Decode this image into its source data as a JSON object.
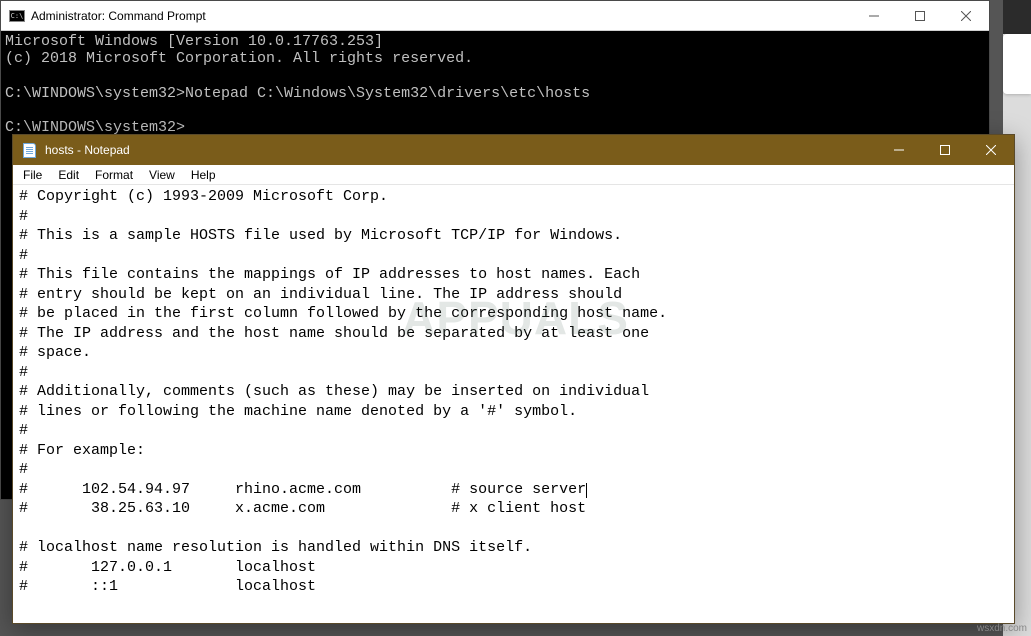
{
  "cmd": {
    "title": "Administrator: Command Prompt",
    "lines": [
      "Microsoft Windows [Version 10.0.17763.253]",
      "(c) 2018 Microsoft Corporation. All rights reserved.",
      "",
      "C:\\WINDOWS\\system32>Notepad C:\\Windows\\System32\\drivers\\etc\\hosts",
      "",
      "C:\\WINDOWS\\system32>"
    ]
  },
  "notepad": {
    "title": "hosts - Notepad",
    "menu": {
      "file": "File",
      "edit": "Edit",
      "format": "Format",
      "view": "View",
      "help": "Help"
    },
    "content": "# Copyright (c) 1993-2009 Microsoft Corp.\n#\n# This is a sample HOSTS file used by Microsoft TCP/IP for Windows.\n#\n# This file contains the mappings of IP addresses to host names. Each\n# entry should be kept on an individual line. The IP address should\n# be placed in the first column followed by the corresponding host name.\n# The IP address and the host name should be separated by at least one\n# space.\n#\n# Additionally, comments (such as these) may be inserted on individual\n# lines or following the machine name denoted by a '#' symbol.\n#\n# For example:\n#\n#      102.54.94.97     rhino.acme.com          # source server",
    "content2": "\n#       38.25.63.10     x.acme.com              # x client host\n\n# localhost name resolution is handled within DNS itself.\n#       127.0.0.1       localhost\n#       ::1             localhost"
  },
  "watermark": {
    "text": "APPUALS",
    "credit": "wsxdn.com"
  }
}
